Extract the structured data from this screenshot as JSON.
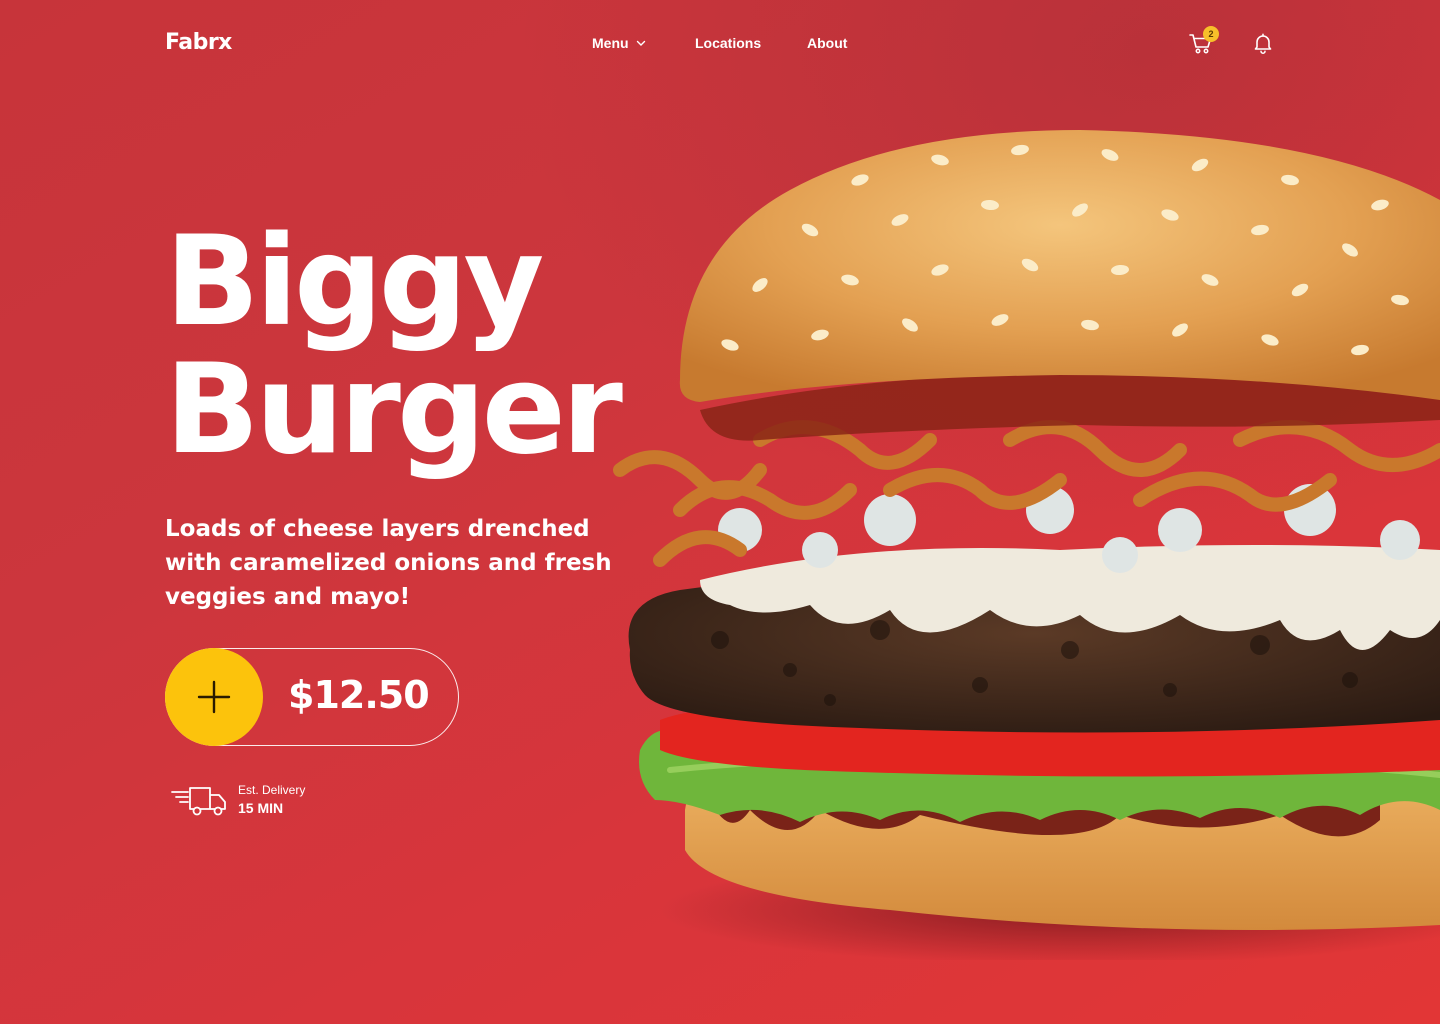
{
  "header": {
    "logo": "Fabrx",
    "nav": [
      {
        "label": "Menu",
        "has_dropdown": true
      },
      {
        "label": "Locations"
      },
      {
        "label": "About"
      }
    ],
    "cart_icon": "cart-icon",
    "cart_count": "2",
    "bell_icon": "bell-icon"
  },
  "hero": {
    "title_line1": "Biggy",
    "title_line2": "Burger",
    "description": "Loads of cheese layers drenched with caramelized onions and fresh veggies and mayo!",
    "add_icon": "plus-icon",
    "price": "$12.50",
    "delivery_icon": "delivery-truck-icon",
    "delivery_label": "Est. Delivery",
    "delivery_time": "15 MIN"
  },
  "colors": {
    "background": "#d2353b",
    "accent": "#fcc30c",
    "text": "#ffffff"
  }
}
